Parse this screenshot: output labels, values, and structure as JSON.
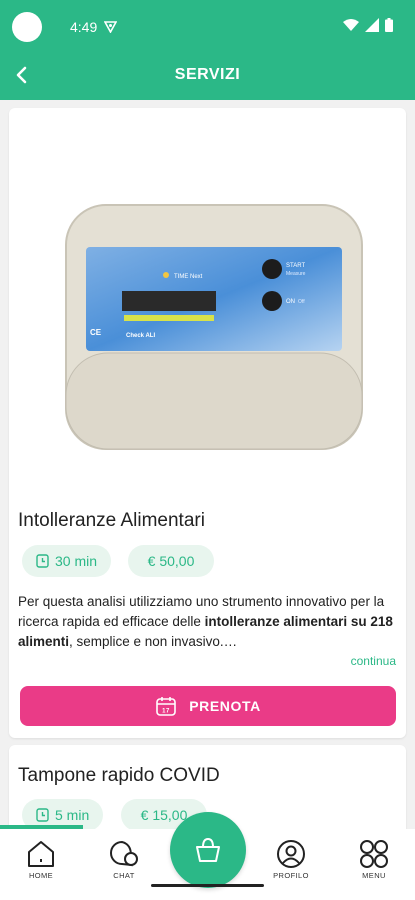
{
  "status_bar": {
    "time": "4:49"
  },
  "header": {
    "title": "SERVIZI"
  },
  "services": [
    {
      "name": "Intolleranze Alimentari",
      "duration": "30 min",
      "price": "€ 50,00",
      "description_part1": "Per questa analisi utilizziamo uno strumento innovativo per la ricerca rapida ed efficace delle ",
      "description_bold": "intolleranze alimentari su 218 alimenti",
      "description_part2": ",  semplice e non invasivo.…",
      "more_label": "continua",
      "book_label": "PRENOTA",
      "device_labels": {
        "start": "START",
        "start_sub": "Measure",
        "on": "ON",
        "on_sub": "Off",
        "brand": "Check ALI",
        "time": "TIME Next"
      }
    },
    {
      "name": "Tampone rapido COVID",
      "duration": "5 min",
      "price": "€ 15,00"
    }
  ],
  "nav": {
    "home": "HOME",
    "chat": "CHAT",
    "profile": "PROFILO",
    "menu": "MENU"
  },
  "colors": {
    "primary": "#2bb887",
    "accent": "#ea3b87"
  },
  "progress_fraction": 0.2
}
